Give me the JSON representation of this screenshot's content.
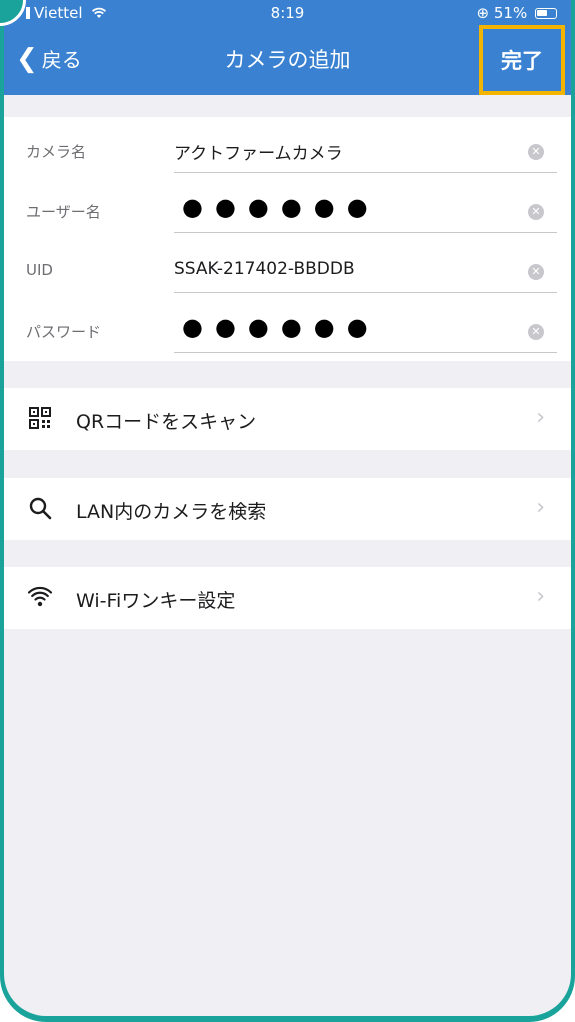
{
  "status_bar": {
    "carrier": "Viettel",
    "time": "8:19",
    "battery": "51%"
  },
  "nav": {
    "back_label": "戻る",
    "title": "カメラの追加",
    "done_label": "完了"
  },
  "form": {
    "camera_name": {
      "label": "カメラ名",
      "value": "アクトファームカメラ"
    },
    "username": {
      "label": "ユーザー名",
      "value": "●●●●●●"
    },
    "uid": {
      "label": "UID",
      "value": "SSAK-217402-BBDDB"
    },
    "password": {
      "label": "パスワード",
      "value": "●●●●●●"
    }
  },
  "actions": [
    {
      "label": "QRコードをスキャン",
      "icon": "qr-code-icon"
    },
    {
      "label": "LAN内のカメラを検索",
      "icon": "search-icon"
    },
    {
      "label": "Wi-Fiワンキー設定",
      "icon": "wifi-icon"
    }
  ],
  "colors": {
    "nav_bar": "#3a82d1",
    "highlight": "#f3b400",
    "frame": "#1aa39a",
    "background": "#efeff4"
  }
}
